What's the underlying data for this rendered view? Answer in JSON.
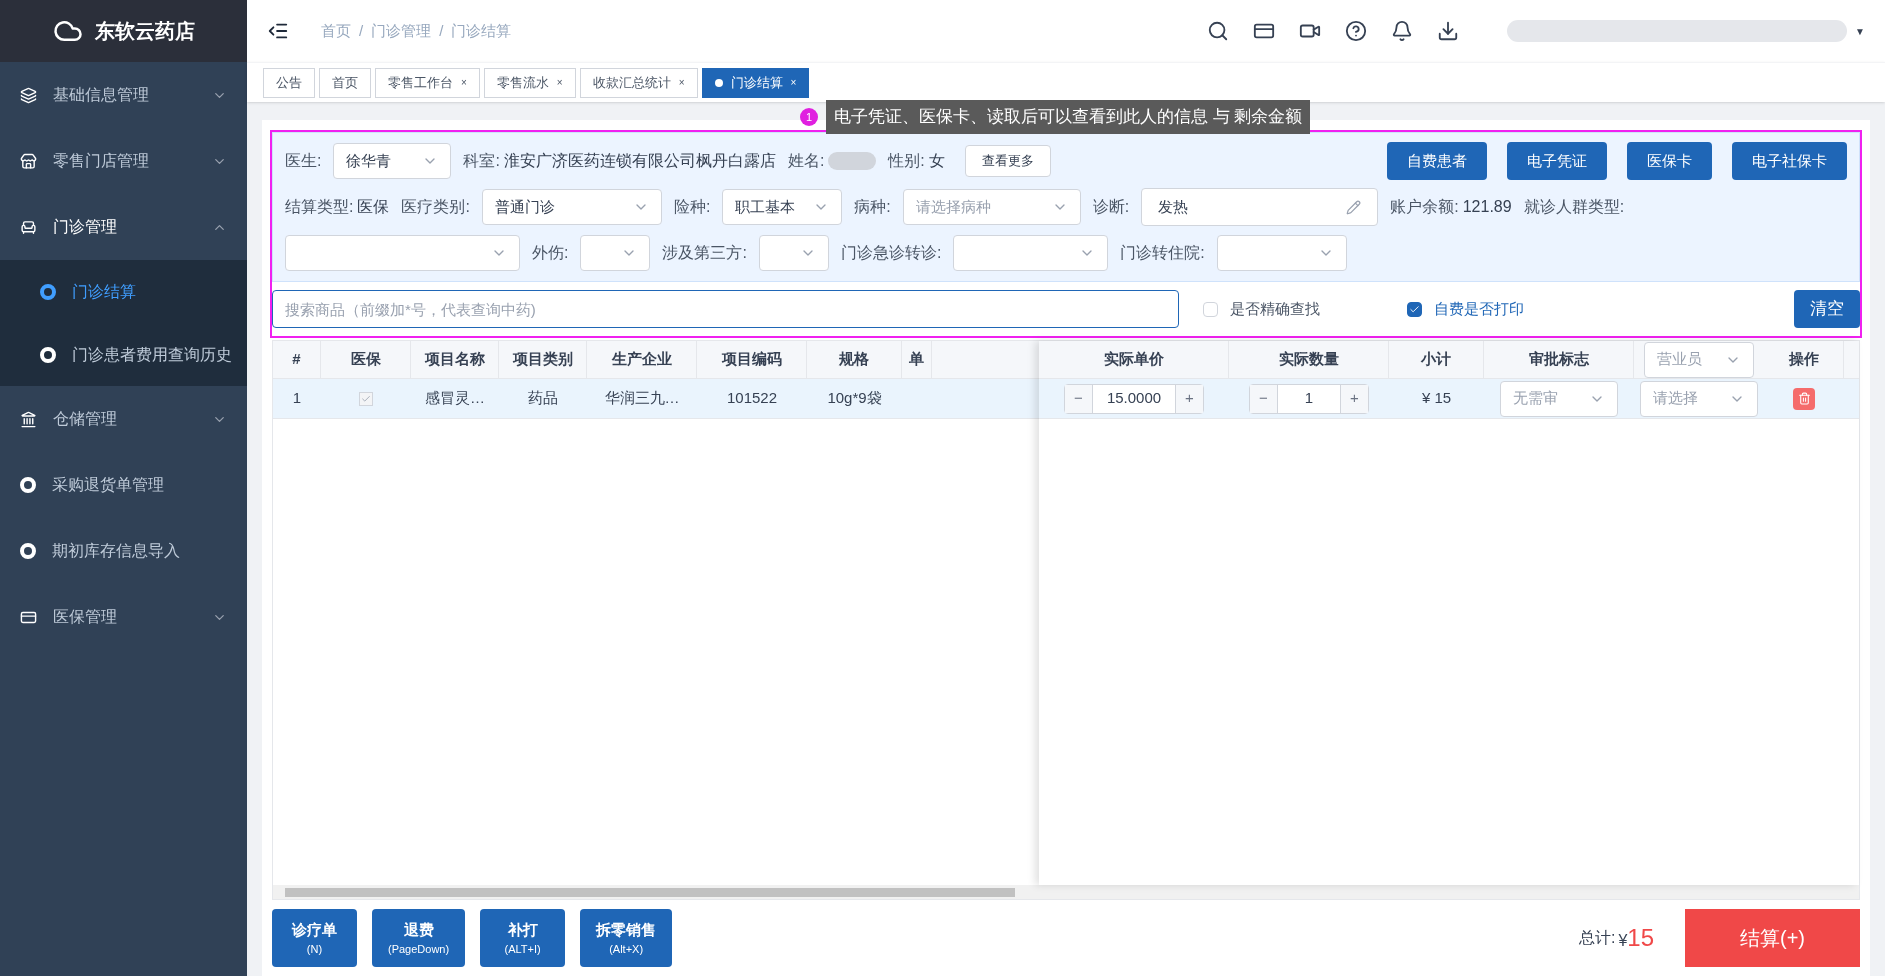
{
  "brand": {
    "name": "东软云药店"
  },
  "sidebar": {
    "items": [
      {
        "label": "基础信息管理",
        "expanded": false,
        "has_arrow": true
      },
      {
        "label": "零售门店管理",
        "expanded": false,
        "has_arrow": true
      },
      {
        "label": "门诊管理",
        "expanded": true,
        "has_arrow": true,
        "children": [
          {
            "label": "门诊结算",
            "selected": true
          },
          {
            "label": "门诊患者费用查询历史",
            "selected": false
          }
        ]
      },
      {
        "label": "仓储管理",
        "expanded": false,
        "has_arrow": true
      },
      {
        "label": "采购退货单管理",
        "expanded": false,
        "has_arrow": false
      },
      {
        "label": "期初库存信息导入",
        "expanded": false,
        "has_arrow": false
      },
      {
        "label": "医保管理",
        "expanded": false,
        "has_arrow": true
      }
    ]
  },
  "breadcrumb": {
    "separator": "/",
    "items": [
      "首页",
      "门诊管理",
      "门诊结算"
    ]
  },
  "user_menu": {
    "caret": "▼"
  },
  "tabs": [
    {
      "label": "公告",
      "selected": false
    },
    {
      "label": "首页",
      "selected": false
    },
    {
      "label": "零售工作台",
      "close": "×",
      "selected": false
    },
    {
      "label": "零售流水",
      "close": "×",
      "selected": false
    },
    {
      "label": "收款汇总统计",
      "close": "×",
      "selected": false
    },
    {
      "label": "门诊结算",
      "close": "×",
      "selected": true
    }
  ],
  "tooltip": {
    "badge": "1",
    "text": "电子凭证、医保卡、读取后可以查看到此人的信息 与 剩余金额"
  },
  "form": {
    "doctor": {
      "label": "医生:",
      "value": "徐华青"
    },
    "dept": {
      "label": "科室:",
      "value": "淮安广济医药连锁有限公司枫丹白露店"
    },
    "name": {
      "label": "姓名:"
    },
    "gender": {
      "label": "性别:",
      "value": "女"
    },
    "more_button": "查看更多",
    "action_buttons": [
      "自费患者",
      "电子凭证",
      "医保卡",
      "电子社保卡"
    ],
    "settle_type": {
      "label": "结算类型:",
      "value": "医保"
    },
    "med_type": {
      "label": "医疗类别:",
      "value": "普通门诊"
    },
    "insurance": {
      "label": "险种:",
      "value": "职工基本"
    },
    "disease": {
      "label": "病种:",
      "placeholder": "请选择病种"
    },
    "diagnosis": {
      "label": "诊断:",
      "value": "发热"
    },
    "balance": {
      "label": "账户余额:",
      "value": "121.89"
    },
    "crowd": {
      "label": "就诊人群类型:"
    },
    "injury": {
      "label": "外伤:"
    },
    "third": {
      "label": "涉及第三方:"
    },
    "emergency": {
      "label": "门诊急诊转诊:"
    },
    "hospital": {
      "label": "门诊转住院:"
    }
  },
  "search": {
    "placeholder": "搜索商品（前缀加*号，代表查询中药)",
    "options": [
      {
        "label": "是否精确查找",
        "checked": false
      },
      {
        "label": "自费是否打印",
        "checked": true
      }
    ],
    "clear_button": "清空"
  },
  "table": {
    "columns": [
      "#",
      "医保",
      "项目名称",
      "项目类别",
      "生产企业",
      "项目编码",
      "规格",
      "单"
    ],
    "fixed_columns": [
      "实际单价",
      "实际数量",
      "小计",
      "审批标志",
      "营业员",
      "操作"
    ],
    "rows": [
      {
        "index": "1",
        "insured": true,
        "name": "感冒灵…",
        "category": "药品",
        "maker": "华润三九…",
        "code": "101522",
        "spec": "10g*9袋",
        "price": "15.0000",
        "qty": "1",
        "subtotal": "¥ 15",
        "approval": "无需审",
        "seller": "请选择",
        "stepper_minus": "−",
        "stepper_plus": "+"
      }
    ]
  },
  "bottom_buttons": [
    {
      "label": "诊疗单",
      "key": "(N)"
    },
    {
      "label": "退费",
      "key": "(PageDown)"
    },
    {
      "label": "补打",
      "key": "(ALT+I)"
    },
    {
      "label": "拆零销售",
      "key": "(Alt+X)"
    }
  ],
  "total": {
    "label": "总计:",
    "currency": "¥",
    "value": "15"
  },
  "settle_button": "结算(+)"
}
